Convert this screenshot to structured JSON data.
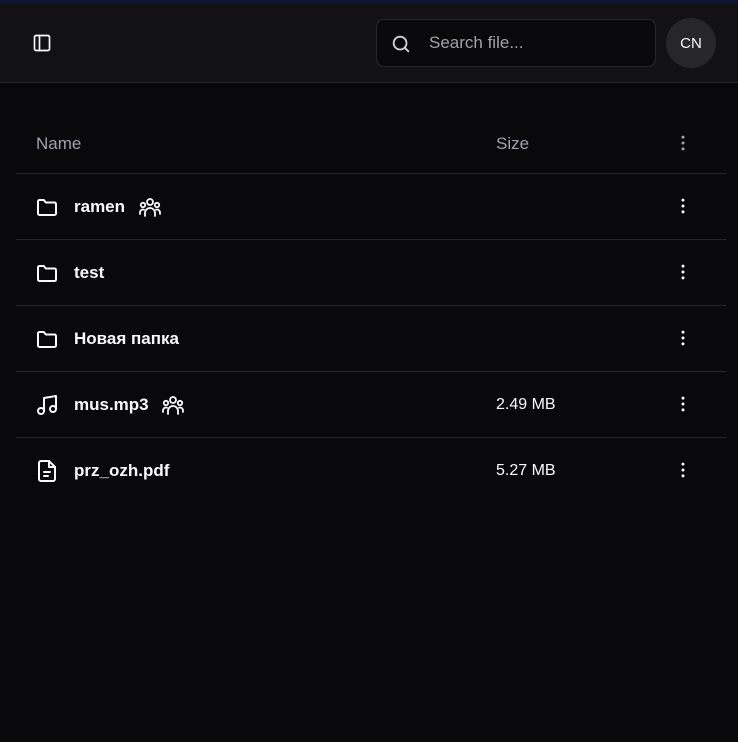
{
  "header": {
    "sidebar_toggle_icon": "sidebar-panel-icon",
    "search": {
      "placeholder": "Search file...",
      "value": "",
      "icon": "search-icon"
    },
    "avatar": {
      "initials": "CN"
    }
  },
  "table": {
    "columns": {
      "name": "Name",
      "size": "Size"
    },
    "rows": [
      {
        "name": "ramen",
        "type": "folder",
        "size": "",
        "shared": true
      },
      {
        "name": "test",
        "type": "folder",
        "size": "",
        "shared": false
      },
      {
        "name": "Новая папка",
        "type": "folder",
        "size": "",
        "shared": false
      },
      {
        "name": "mus.mp3",
        "type": "audio",
        "size": "2.49 MB",
        "shared": true
      },
      {
        "name": "prz_ozh.pdf",
        "type": "document",
        "size": "5.27 MB",
        "shared": false
      }
    ]
  },
  "colors": {
    "background": "#09090b",
    "header": "#121214",
    "border": "#27272a",
    "muted_text": "#a1a1aa",
    "text": "#fafafa"
  }
}
